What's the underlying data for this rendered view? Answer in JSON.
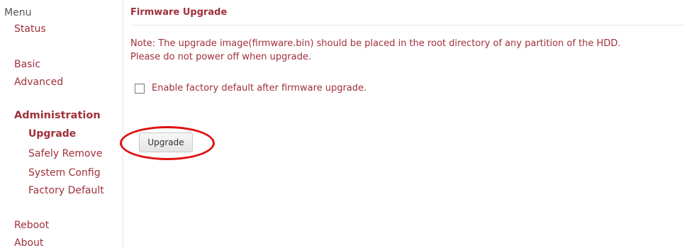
{
  "sidebar": {
    "menu_label": "Menu",
    "status": "Status",
    "basic": "Basic",
    "advanced": "Advanced",
    "administration": "Administration",
    "admin_items": {
      "upgrade": "Upgrade",
      "safely_remove": "Safely Remove",
      "system_config": "System Config",
      "factory_default": "Factory Default"
    },
    "reboot": "Reboot",
    "about": "About"
  },
  "main": {
    "title": "Firmware Upgrade",
    "note_line1": "Note: The upgrade image(firmware.bin) should be placed in the root directory of any partition of the HDD.",
    "note_line2": "Please do not power off when upgrade.",
    "checkbox_label": "Enable factory default after firmware upgrade.",
    "checkbox_checked": false,
    "upgrade_button": "Upgrade"
  },
  "colors": {
    "accent": "#a0303a",
    "highlight": "#e01010"
  }
}
